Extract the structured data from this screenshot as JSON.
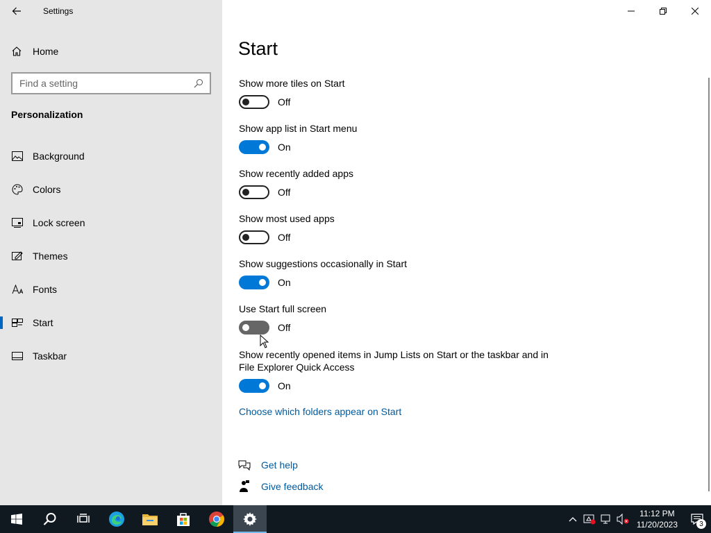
{
  "window": {
    "app_title": "Settings",
    "controls": [
      "minimize",
      "restore",
      "close"
    ]
  },
  "sidebar": {
    "home_label": "Home",
    "search_placeholder": "Find a setting",
    "section_title": "Personalization",
    "items": [
      {
        "label": "Background",
        "icon": "background-icon"
      },
      {
        "label": "Colors",
        "icon": "palette-icon"
      },
      {
        "label": "Lock screen",
        "icon": "lock-screen-icon"
      },
      {
        "label": "Themes",
        "icon": "themes-icon"
      },
      {
        "label": "Fonts",
        "icon": "fonts-icon"
      },
      {
        "label": "Start",
        "icon": "start-icon",
        "active": true
      },
      {
        "label": "Taskbar",
        "icon": "taskbar-icon"
      }
    ]
  },
  "main": {
    "title": "Start",
    "settings": [
      {
        "label": "Show more tiles on Start",
        "state": "Off",
        "on": false
      },
      {
        "label": "Show app list in Start menu",
        "state": "On",
        "on": true
      },
      {
        "label": "Show recently added apps",
        "state": "Off",
        "on": false
      },
      {
        "label": "Show most used apps",
        "state": "Off",
        "on": false
      },
      {
        "label": "Show suggestions occasionally in Start",
        "state": "On",
        "on": true
      },
      {
        "label": "Use Start full screen",
        "state": "Off",
        "on": false
      },
      {
        "label": "Show recently opened items in Jump Lists on Start or the taskbar and in File Explorer Quick Access",
        "state": "On",
        "on": true
      }
    ],
    "folders_link": "Choose which folders appear on Start",
    "help_link": "Get help",
    "feedback_link": "Give feedback"
  },
  "taskbar": {
    "apps": [
      "windows-start",
      "search",
      "task-view",
      "edge",
      "file-explorer",
      "microsoft-store",
      "chrome",
      "settings"
    ],
    "time": "11:12 PM",
    "date": "11/20/2023",
    "notification_count": "3"
  },
  "colors": {
    "accent": "#0078d7",
    "link": "#005a9e",
    "sidebar_bg": "#e6e6e6",
    "taskbar_bg": "#101820"
  }
}
